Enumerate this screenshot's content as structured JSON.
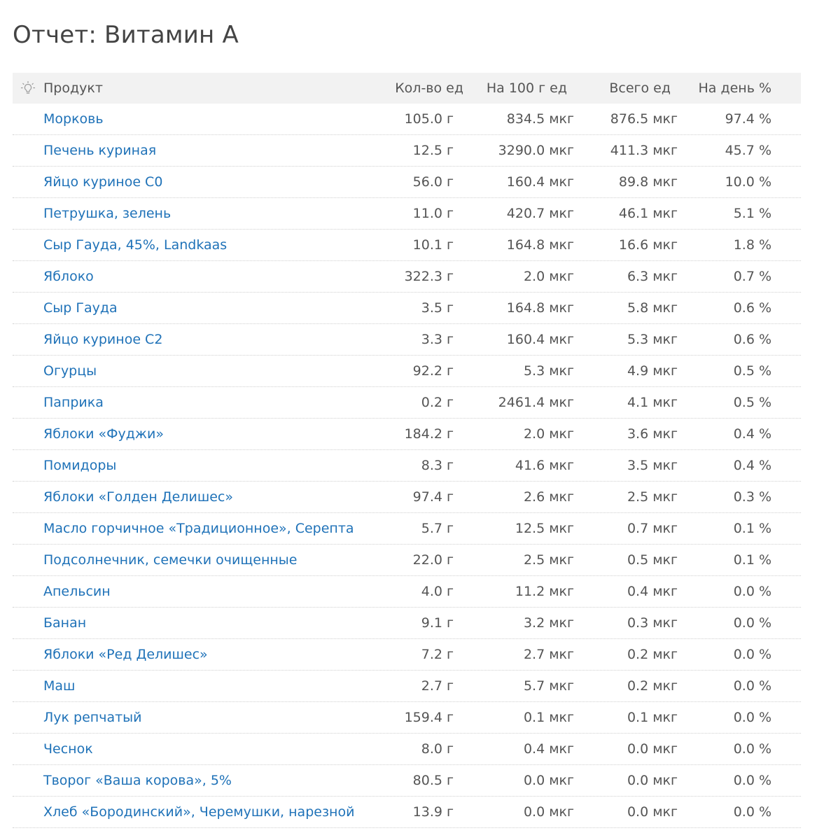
{
  "page": {
    "title": "Отчет: Витамин А"
  },
  "table": {
    "headers": {
      "product": "Продукт",
      "qty": "Кол-во ед",
      "per100": "На 100 г ед",
      "total": "Всего ед",
      "daily": "На день %"
    },
    "header_icon": "lightbulb-icon",
    "rows": [
      {
        "name": "Морковь",
        "qty": "105.0 г",
        "per100": "834.5 мкг",
        "total": "876.5 мкг",
        "daily": "97.4 %"
      },
      {
        "name": "Печень куриная",
        "qty": "12.5 г",
        "per100": "3290.0 мкг",
        "total": "411.3 мкг",
        "daily": "45.7 %"
      },
      {
        "name": "Яйцо куриное С0",
        "qty": "56.0 г",
        "per100": "160.4 мкг",
        "total": "89.8 мкг",
        "daily": "10.0 %"
      },
      {
        "name": "Петрушка, зелень",
        "qty": "11.0 г",
        "per100": "420.7 мкг",
        "total": "46.1 мкг",
        "daily": "5.1 %"
      },
      {
        "name": "Сыр Гауда, 45%, Landkaas",
        "qty": "10.1 г",
        "per100": "164.8 мкг",
        "total": "16.6 мкг",
        "daily": "1.8 %"
      },
      {
        "name": "Яблоко",
        "qty": "322.3 г",
        "per100": "2.0 мкг",
        "total": "6.3 мкг",
        "daily": "0.7 %"
      },
      {
        "name": "Сыр Гауда",
        "qty": "3.5 г",
        "per100": "164.8 мкг",
        "total": "5.8 мкг",
        "daily": "0.6 %"
      },
      {
        "name": "Яйцо куриное С2",
        "qty": "3.3 г",
        "per100": "160.4 мкг",
        "total": "5.3 мкг",
        "daily": "0.6 %"
      },
      {
        "name": "Огурцы",
        "qty": "92.2 г",
        "per100": "5.3 мкг",
        "total": "4.9 мкг",
        "daily": "0.5 %"
      },
      {
        "name": "Паприка",
        "qty": "0.2 г",
        "per100": "2461.4 мкг",
        "total": "4.1 мкг",
        "daily": "0.5 %"
      },
      {
        "name": "Яблоки «Фуджи»",
        "qty": "184.2 г",
        "per100": "2.0 мкг",
        "total": "3.6 мкг",
        "daily": "0.4 %"
      },
      {
        "name": "Помидоры",
        "qty": "8.3 г",
        "per100": "41.6 мкг",
        "total": "3.5 мкг",
        "daily": "0.4 %"
      },
      {
        "name": "Яблоки «Голден Делишес»",
        "qty": "97.4 г",
        "per100": "2.6 мкг",
        "total": "2.5 мкг",
        "daily": "0.3 %"
      },
      {
        "name": "Масло горчичное «Традиционное», Серепта",
        "qty": "5.7 г",
        "per100": "12.5 мкг",
        "total": "0.7 мкг",
        "daily": "0.1 %"
      },
      {
        "name": "Подсолнечник, семечки очищенные",
        "qty": "22.0 г",
        "per100": "2.5 мкг",
        "total": "0.5 мкг",
        "daily": "0.1 %"
      },
      {
        "name": "Апельсин",
        "qty": "4.0 г",
        "per100": "11.2 мкг",
        "total": "0.4 мкг",
        "daily": "0.0 %"
      },
      {
        "name": "Банан",
        "qty": "9.1 г",
        "per100": "3.2 мкг",
        "total": "0.3 мкг",
        "daily": "0.0 %"
      },
      {
        "name": "Яблоки «Ред Делишес»",
        "qty": "7.2 г",
        "per100": "2.7 мкг",
        "total": "0.2 мкг",
        "daily": "0.0 %"
      },
      {
        "name": "Маш",
        "qty": "2.7 г",
        "per100": "5.7 мкг",
        "total": "0.2 мкг",
        "daily": "0.0 %"
      },
      {
        "name": "Лук репчатый",
        "qty": "159.4 г",
        "per100": "0.1 мкг",
        "total": "0.1 мкг",
        "daily": "0.0 %"
      },
      {
        "name": "Чеснок",
        "qty": "8.0 г",
        "per100": "0.4 мкг",
        "total": "0.0 мкг",
        "daily": "0.0 %"
      },
      {
        "name": "Творог «Ваша корова», 5%",
        "qty": "80.5 г",
        "per100": "0.0 мкг",
        "total": "0.0 мкг",
        "daily": "0.0 %"
      },
      {
        "name": "Хлеб «Бородинский», Черемушки, нарезной",
        "qty": "13.9 г",
        "per100": "0.0 мкг",
        "total": "0.0 мкг",
        "daily": "0.0 %"
      }
    ]
  },
  "colors": {
    "link": "#1f72b8",
    "text": "#555555",
    "header_bg": "#f2f2f2",
    "divider": "#cfcfcf"
  }
}
